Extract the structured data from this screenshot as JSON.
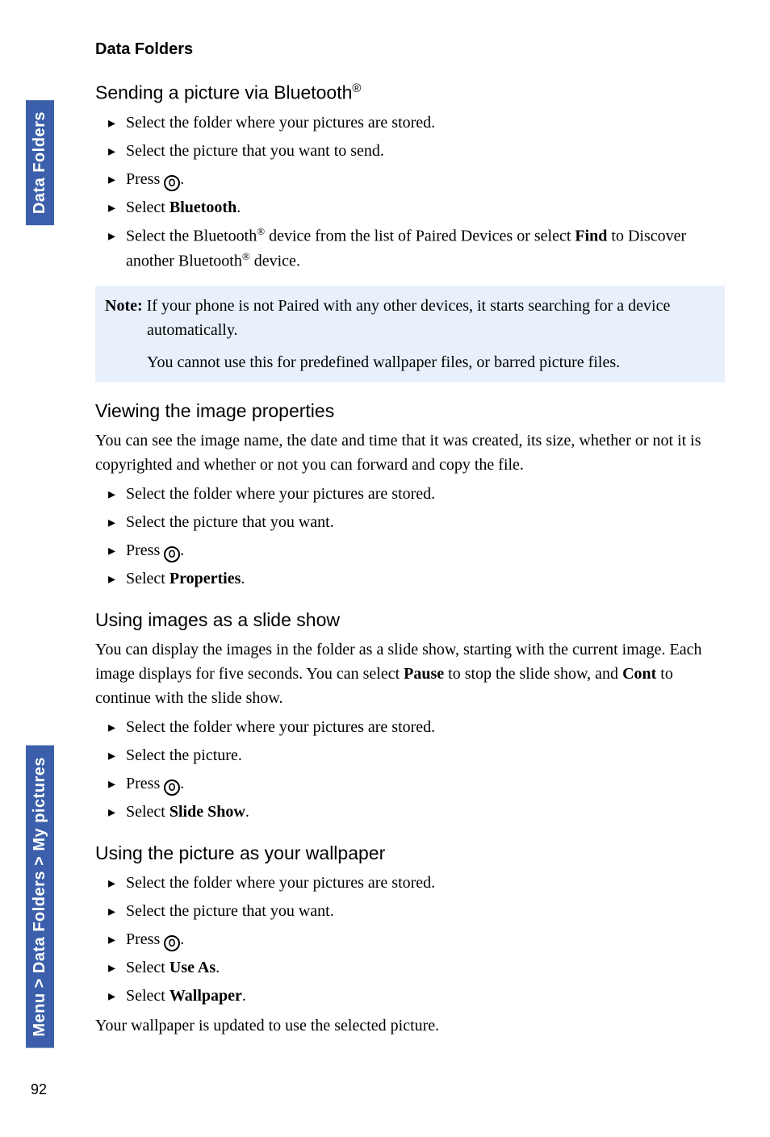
{
  "side": {
    "tab1": "Data Folders",
    "tab2": "Menu > Data Folders > My pictures"
  },
  "header": "Data Folders",
  "section1": {
    "title_pre": "Sending a picture via Bluetooth",
    "sup": "®",
    "items": {
      "i1": "Select the folder where your pictures are stored.",
      "i2": "Select the picture that you want to send.",
      "i3_pre": "Press ",
      "i3_post": ".",
      "i4_pre": "Select ",
      "i4_bold": "Bluetooth",
      "i4_post": ".",
      "i5_pre": "Select the Bluetooth",
      "i5_sup1": "®",
      "i5_mid1": " device from the list of Paired Devices or select ",
      "i5_bold": "Find",
      "i5_mid2": " to Discover another Bluetooth",
      "i5_sup2": "®",
      "i5_post": " device."
    }
  },
  "note": {
    "label": "Note:",
    "line1": " If your phone is not Paired with any other devices, it starts searching for a device automatically.",
    "line2": "You cannot use this for predefined wallpaper files, or barred picture files."
  },
  "section2": {
    "title": "Viewing the image properties",
    "intro": "You can see the image name, the date and time that it was created, its size, whether or not it is copyrighted and whether or not you can forward and copy the file.",
    "items": {
      "i1": "Select the folder where your pictures are stored.",
      "i2": "Select the picture that you want.",
      "i3_pre": "Press ",
      "i3_post": ".",
      "i4_pre": "Select ",
      "i4_bold": "Properties",
      "i4_post": "."
    }
  },
  "section3": {
    "title": "Using images as a slide show",
    "intro_pre": "You can display the images in the folder as a slide show, starting with the current image. Each image displays for five seconds. You can select ",
    "intro_b1": "Pause",
    "intro_mid": " to stop the slide show, and ",
    "intro_b2": "Cont",
    "intro_post": " to continue with the slide show.",
    "items": {
      "i1": "Select the folder where your pictures are stored.",
      "i2": "Select the picture.",
      "i3_pre": "Press ",
      "i3_post": ".",
      "i4_pre": "Select ",
      "i4_bold": "Slide Show",
      "i4_post": "."
    }
  },
  "section4": {
    "title": "Using the picture as your wallpaper",
    "items": {
      "i1": "Select the folder where your pictures are stored.",
      "i2": "Select the picture that you want.",
      "i3_pre": "Press ",
      "i3_post": ".",
      "i4_pre": "Select ",
      "i4_bold": "Use As",
      "i4_post": ".",
      "i5_pre": "Select ",
      "i5_bold": "Wallpaper",
      "i5_post": "."
    },
    "outro": "Your wallpaper is updated to use the selected picture."
  },
  "page_number": "92"
}
